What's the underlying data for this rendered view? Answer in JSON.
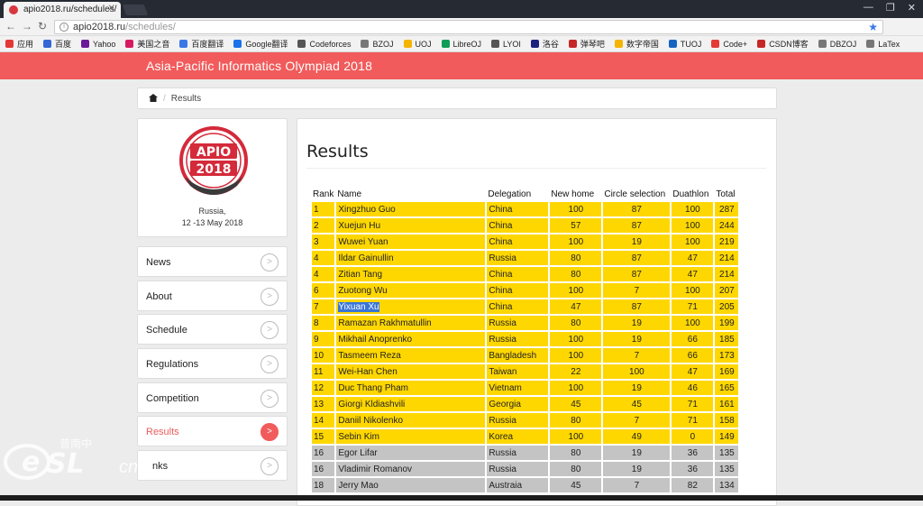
{
  "browser": {
    "tab_title": "apio2018.ru/schedules/",
    "url_host": "apio2018.ru",
    "url_path": "/schedules/",
    "bookmarks": [
      "应用",
      "百度",
      "Yahoo",
      "美国之音",
      "百度翻译",
      "Google翻译",
      "Codeforces",
      "BZOJ",
      "UOJ",
      "LibreOJ",
      "LYOI",
      "洛谷",
      "弹琴吧",
      "数字帝国",
      "TUOJ",
      "Code+",
      "CSDN博客",
      "DBZOJ",
      "LaTex"
    ]
  },
  "site": {
    "title": "Asia-Pacific Informatics Olympiad 2018",
    "breadcrumb_current": "Results",
    "logo_text_top": "APIO",
    "logo_text_bottom": "2018",
    "location": "Russia,",
    "dates": "12 -13 May 2018"
  },
  "nav": {
    "items": [
      {
        "label": "News"
      },
      {
        "label": "About"
      },
      {
        "label": "Schedule"
      },
      {
        "label": "Regulations"
      },
      {
        "label": "Competition"
      },
      {
        "label": "Results"
      },
      {
        "label": "nks"
      }
    ],
    "arrow": ">"
  },
  "results": {
    "heading": "Results",
    "columns": [
      "Rank",
      "Name",
      "Delegation",
      "New home",
      "Circle selection",
      "Duathlon",
      "Total"
    ],
    "rows": [
      {
        "rank": "1",
        "name": "Xingzhuo Guo",
        "delegation": "China",
        "new_home": "100",
        "circle": "87",
        "duathlon": "100",
        "total": "287",
        "medal": "gold"
      },
      {
        "rank": "2",
        "name": "Xuejun Hu",
        "delegation": "China",
        "new_home": "57",
        "circle": "87",
        "duathlon": "100",
        "total": "244",
        "medal": "gold"
      },
      {
        "rank": "3",
        "name": "Wuwei Yuan",
        "delegation": "China",
        "new_home": "100",
        "circle": "19",
        "duathlon": "100",
        "total": "219",
        "medal": "gold"
      },
      {
        "rank": "4",
        "name": "Ildar Gainullin",
        "delegation": "Russia",
        "new_home": "80",
        "circle": "87",
        "duathlon": "47",
        "total": "214",
        "medal": "gold"
      },
      {
        "rank": "4",
        "name": "Zitian Tang",
        "delegation": "China",
        "new_home": "80",
        "circle": "87",
        "duathlon": "47",
        "total": "214",
        "medal": "gold"
      },
      {
        "rank": "6",
        "name": "Zuotong Wu",
        "delegation": "China",
        "new_home": "100",
        "circle": "7",
        "duathlon": "100",
        "total": "207",
        "medal": "gold"
      },
      {
        "rank": "7",
        "name": "Yixuan Xu",
        "delegation": "China",
        "new_home": "47",
        "circle": "87",
        "duathlon": "71",
        "total": "205",
        "medal": "gold",
        "selected": true
      },
      {
        "rank": "8",
        "name": "Ramazan Rakhmatullin",
        "delegation": "Russia",
        "new_home": "80",
        "circle": "19",
        "duathlon": "100",
        "total": "199",
        "medal": "gold"
      },
      {
        "rank": "9",
        "name": "Mikhail Anoprenko",
        "delegation": "Russia",
        "new_home": "100",
        "circle": "19",
        "duathlon": "66",
        "total": "185",
        "medal": "gold"
      },
      {
        "rank": "10",
        "name": "Tasmeem Reza",
        "delegation": "Bangladesh",
        "new_home": "100",
        "circle": "7",
        "duathlon": "66",
        "total": "173",
        "medal": "gold"
      },
      {
        "rank": "11",
        "name": "Wei-Han Chen",
        "delegation": "Taiwan",
        "new_home": "22",
        "circle": "100",
        "duathlon": "47",
        "total": "169",
        "medal": "gold"
      },
      {
        "rank": "12",
        "name": "Duc Thang Pham",
        "delegation": "Vietnam",
        "new_home": "100",
        "circle": "19",
        "duathlon": "46",
        "total": "165",
        "medal": "gold"
      },
      {
        "rank": "13",
        "name": "Giorgi Kldiashvili",
        "delegation": "Georgia",
        "new_home": "45",
        "circle": "45",
        "duathlon": "71",
        "total": "161",
        "medal": "gold"
      },
      {
        "rank": "14",
        "name": "Daniil Nikolenko",
        "delegation": "Russia",
        "new_home": "80",
        "circle": "7",
        "duathlon": "71",
        "total": "158",
        "medal": "gold"
      },
      {
        "rank": "15",
        "name": "Sebin Kim",
        "delegation": "Korea",
        "new_home": "100",
        "circle": "49",
        "duathlon": "0",
        "total": "149",
        "medal": "gold"
      },
      {
        "rank": "16",
        "name": "Egor Lifar",
        "delegation": "Russia",
        "new_home": "80",
        "circle": "19",
        "duathlon": "36",
        "total": "135",
        "medal": "silver"
      },
      {
        "rank": "16",
        "name": "Vladimir Romanov",
        "delegation": "Russia",
        "new_home": "80",
        "circle": "19",
        "duathlon": "36",
        "total": "135",
        "medal": "silver"
      },
      {
        "rank": "18",
        "name": "Jerry Mao",
        "delegation": "Austraia",
        "new_home": "45",
        "circle": "7",
        "duathlon": "82",
        "total": "134",
        "medal": "silver"
      }
    ]
  },
  "watermark": {
    "text_cn": "普南中",
    "text_url": "cn"
  },
  "colors": {
    "accent": "#f25b5b",
    "gold_row": "#ffd700",
    "silver_row": "#c4c4c4",
    "selection": "#3875d7"
  }
}
